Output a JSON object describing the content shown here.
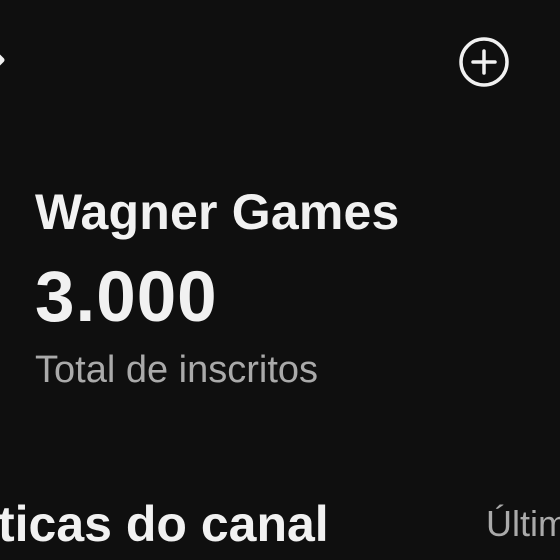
{
  "header": {
    "back_icon": "back-arrow-icon",
    "add_icon": "add-circle-icon"
  },
  "channel": {
    "name": "Wagner Games",
    "subscriber_count": "3.000",
    "subscriber_label": "Total de inscritos"
  },
  "analytics": {
    "section_title": "ticas do canal",
    "period_label": "Últim"
  },
  "colors": {
    "background": "#0f0f0f",
    "primary_text": "#f1f1f1",
    "secondary_text": "#aaaaaa"
  }
}
